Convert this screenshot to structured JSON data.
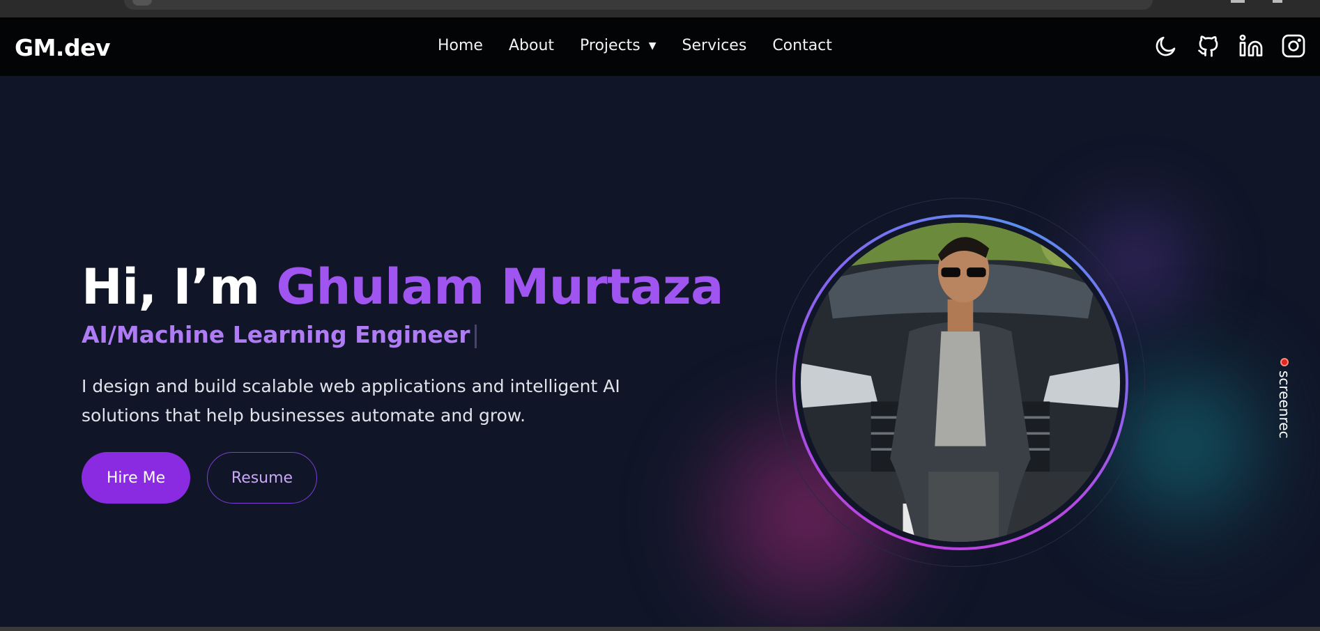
{
  "navbar": {
    "logo": "GM.dev",
    "links": [
      {
        "label": "Home"
      },
      {
        "label": "About"
      },
      {
        "label": "Projects",
        "has_dropdown": true,
        "caret": "▼"
      },
      {
        "label": "Services"
      },
      {
        "label": "Contact"
      }
    ],
    "icons": [
      "moon-icon",
      "github-icon",
      "linkedin-icon",
      "instagram-icon"
    ]
  },
  "hero": {
    "greeting": "Hi, I’m ",
    "name": "Ghulam Murtaza",
    "role": "AI/Machine Learning Engineer",
    "description": "I design and build scalable web applications and intelligent AI solutions that help businesses automate and grow.",
    "hire_button": "Hire Me",
    "resume_button": "Resume"
  },
  "screenrec": {
    "label": "screenrec"
  },
  "colors": {
    "accent": "#8a2be2",
    "name_gradient": "#a155f0",
    "background": "#101628",
    "navbar": "#030406"
  }
}
